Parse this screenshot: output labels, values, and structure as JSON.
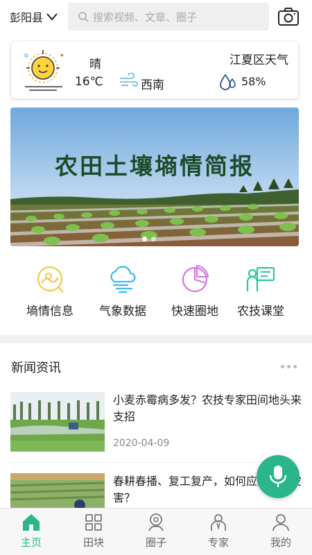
{
  "header": {
    "region": "彭阳县",
    "search_placeholder": "搜索视频、文章、圈子"
  },
  "weather": {
    "title": "江夏区天气",
    "condition": "晴",
    "temperature": "16℃",
    "wind": "西南",
    "humidity": "58%"
  },
  "banner": {
    "title": "农田土壤墒情简报",
    "slide_count": 2,
    "active_slide": 0
  },
  "quick_menu": [
    {
      "label": "墒情信息",
      "icon": "soil-moisture-icon",
      "color": "#f5c842"
    },
    {
      "label": "气象数据",
      "icon": "weather-data-icon",
      "color": "#3cbbe6"
    },
    {
      "label": "快速圈地",
      "icon": "pie-chart-icon",
      "color": "#d774e0"
    },
    {
      "label": "农技课堂",
      "icon": "classroom-icon",
      "color": "#2bc79a"
    }
  ],
  "news": {
    "heading": "新闻资讯",
    "items": [
      {
        "title": "小麦赤霉病多发？农技专家田间地头来支招",
        "date": "2020-04-09"
      },
      {
        "title": "春耕春播、复工复产，如何应对气象灾害？",
        "date": ""
      }
    ]
  },
  "tabs": [
    {
      "label": "主页",
      "icon": "home-icon",
      "active": true
    },
    {
      "label": "田块",
      "icon": "grid-icon",
      "active": false
    },
    {
      "label": "圈子",
      "icon": "circle-icon",
      "active": false
    },
    {
      "label": "专家",
      "icon": "expert-icon",
      "active": false
    },
    {
      "label": "我的",
      "icon": "user-icon",
      "active": false
    }
  ],
  "colors": {
    "accent": "#2bb58a",
    "tab_inactive": "#666666"
  }
}
